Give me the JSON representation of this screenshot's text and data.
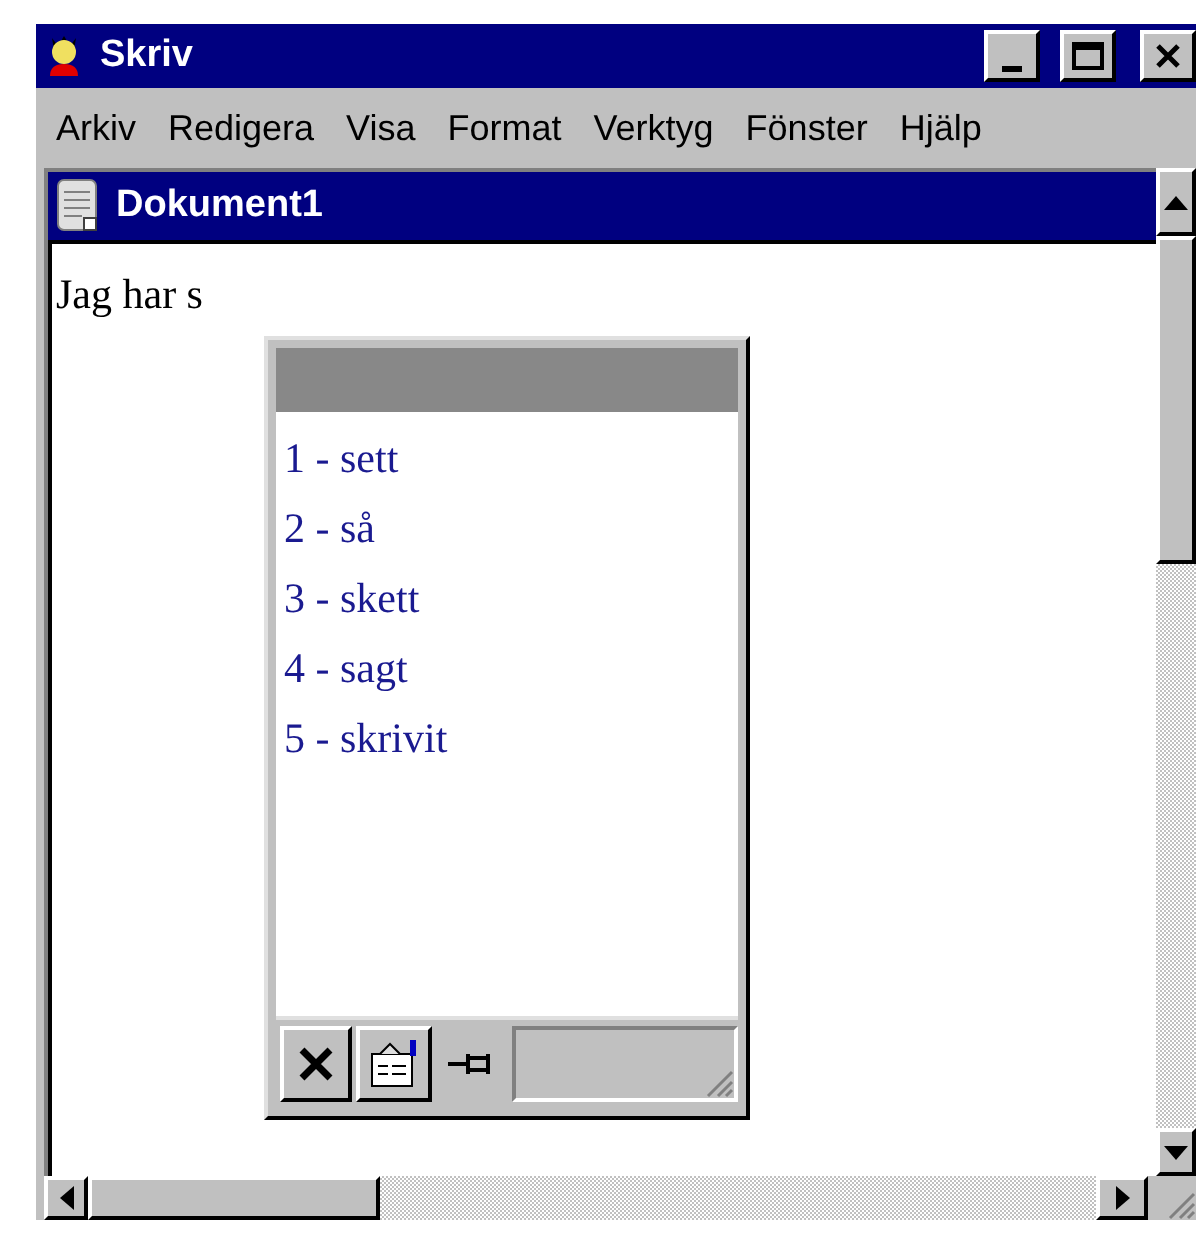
{
  "window": {
    "title": "Skriv"
  },
  "menu": [
    "Arkiv",
    "Redigera",
    "Visa",
    "Format",
    "Verktyg",
    "Fönster",
    "Hjälp"
  ],
  "document": {
    "title": "Dokument1",
    "text": "Jag har s"
  },
  "suggestions": [
    "1 - sett",
    "2 - så",
    "3 - skett",
    "4 - sagt",
    "5 - skrivit"
  ]
}
